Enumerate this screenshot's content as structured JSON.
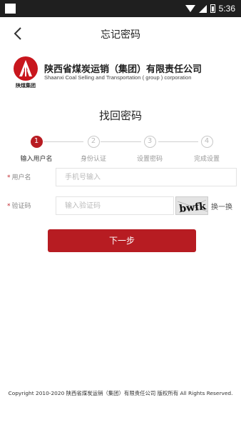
{
  "status_bar": {
    "time": "5:36"
  },
  "navbar": {
    "title": "忘记密码"
  },
  "brand": {
    "name_cn": "陕西省煤炭运销（集团）有限责任公司",
    "name_en": "Shaanxi Coal Selling and Transportation ( group ) corporation",
    "logo_text": "陕煤集团"
  },
  "page_title": "找回密码",
  "steps": [
    {
      "number": "1",
      "label": "输入用户名"
    },
    {
      "number": "2",
      "label": "身份认证"
    },
    {
      "number": "3",
      "label": "设置密码"
    },
    {
      "number": "4",
      "label": "完成设置"
    }
  ],
  "form": {
    "username_label": "用户名",
    "username_placeholder": "手机号输入",
    "captcha_label": "验证码",
    "captcha_placeholder": "输入验证码",
    "captcha_text": "bwfk",
    "refresh_label": "换一换",
    "required_mark": "*"
  },
  "next_button": "下一步",
  "footer": "Copyright 2010-2020 陕西省煤炭运销（集团）有限责任公司 版权所有 All Rights Reserved.",
  "colors": {
    "primary": "#b71c22",
    "status_bar": "#1f1f1f"
  }
}
